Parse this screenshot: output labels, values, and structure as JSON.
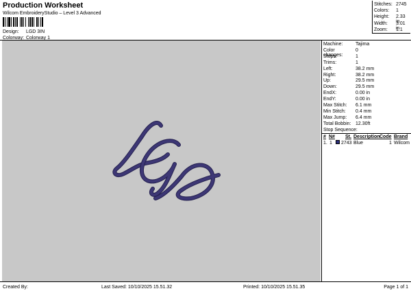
{
  "header": {
    "title": "Production Worksheet",
    "subtitle": "Wilcom EmbroideryStudio – Level 3 Advanced",
    "design_label": "Design:",
    "design_value": "LGD 3IN",
    "colorway_label": "Colorway:",
    "colorway_value": "Colorway 1"
  },
  "stats": [
    {
      "label": "Stitches:",
      "value": "2745"
    },
    {
      "label": "Colors:",
      "value": "1"
    },
    {
      "label": "Height:",
      "value": "2.33 in"
    },
    {
      "label": "Width:",
      "value": "3.01 in"
    },
    {
      "label": "Zoom:",
      "value": "1:1"
    }
  ],
  "design_preview": {
    "thread_color": "#3d3775",
    "thread_shadow": "#24204f"
  },
  "machine_info": [
    {
      "label": "Machine:",
      "value": "Tajima"
    },
    {
      "label": "Color changes:",
      "value": "0"
    },
    {
      "label": "Stops:",
      "value": "1"
    },
    {
      "label": "Trims:",
      "value": "1"
    },
    {
      "label": "Left:",
      "value": "38.2 mm"
    },
    {
      "label": "Right:",
      "value": "38.2 mm"
    },
    {
      "label": "Up:",
      "value": "29.5 mm"
    },
    {
      "label": "Down:",
      "value": "29.5 mm"
    },
    {
      "label": "EndX:",
      "value": "0.00 in"
    },
    {
      "label": "EndY:",
      "value": "0.00 in"
    },
    {
      "label": "Max Stitch:",
      "value": "6.1 mm"
    },
    {
      "label": "Min Stitch:",
      "value": "0.4 mm"
    },
    {
      "label": "Max Jump:",
      "value": "6.4 mm"
    },
    {
      "label": "Total Bobbin:",
      "value": "12.30ft"
    }
  ],
  "stop_sequence": {
    "title": "Stop Sequence:",
    "columns": [
      "#",
      "N#",
      "St.",
      "Description",
      "Code",
      "Brand"
    ],
    "rows": [
      {
        "index": "1.",
        "n": "1",
        "swatch_color": "#2b2f7a",
        "stitches": "2743",
        "description": "Blue",
        "code": "1",
        "brand": "Wilcom"
      }
    ]
  },
  "footer": {
    "created_by": "Created By:",
    "last_saved": "Last Saved: 10/10/2025 15.51.32",
    "printed": "Printed: 10/10/2025 15.51.35",
    "page": "Page 1 of 1"
  }
}
